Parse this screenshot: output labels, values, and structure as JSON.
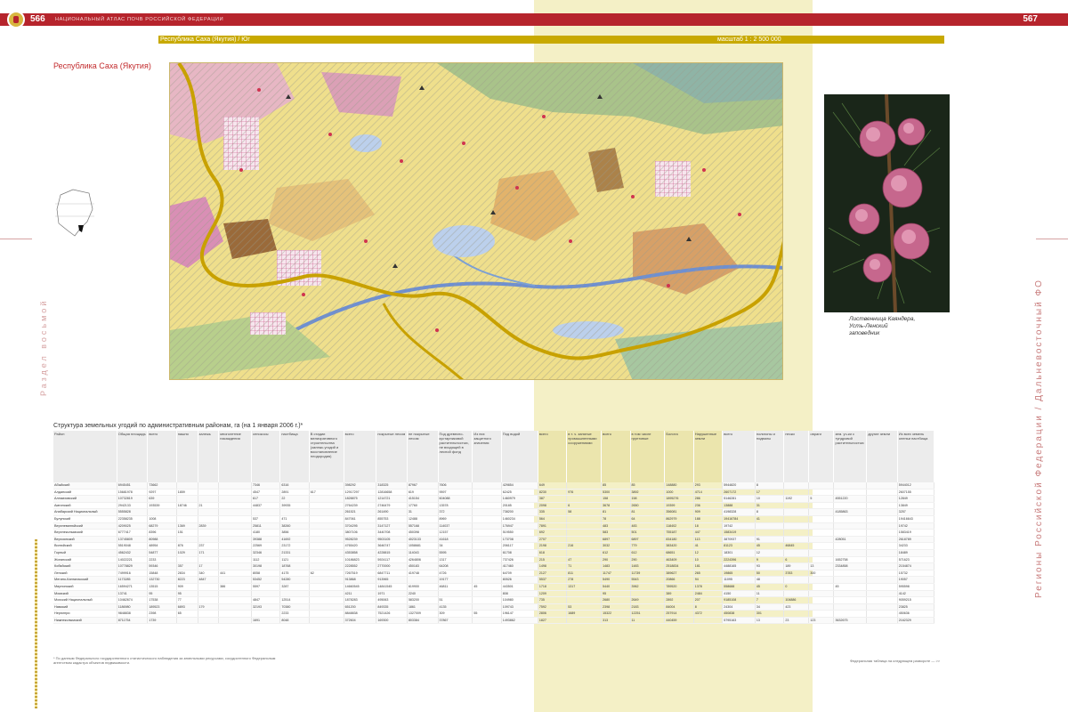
{
  "header": {
    "left_page_number": "566",
    "left_running_title": "национальный атлас почв российской федерации",
    "right_page_number": "567",
    "map_title": "Республика Саха (Якутия) / Юг",
    "scale": "масштаб 1 : 2 500 000"
  },
  "region_title": "Республика Саха (Якутия)",
  "side_labels": {
    "left": "Раздел восьмой",
    "right": "Регионы Российской Федерации / Дальневосточный ФО"
  },
  "photo": {
    "caption_line1": "Лиственница Каяндера,",
    "caption_line2": "Усть-Ленский",
    "caption_line3": "заповедник"
  },
  "table": {
    "title": "Структура земельных угодий по административным районам, га (на 1 января 2006 г.)*",
    "headers": [
      "Район",
      "Общая площадь",
      "всего",
      "пашня",
      "залежь",
      "многолетние насаждения",
      "сенокосы",
      "пастбища",
      "В стадии мелиоративного строительства (залежь угодий и восстановление плодородия)",
      "всего",
      "покрытые лесом",
      "не покрытые лесом",
      "Под древесно-кустарниковой растительностью, не входящей в лесной фонд",
      "Из них защитного значения",
      "Под водой",
      "всего",
      "в т. ч. занятые промышленными сооружениями",
      "всего",
      "в том числе грунтовые",
      "Болота",
      "Нарушенные земли",
      "всего",
      "полигоны и подвалы",
      "пески",
      "овраги",
      "зем. уч-ки с тундровой растительностью",
      "другие земли",
      "Из всех земель оленьи пастбища"
    ],
    "group_headers": {
      "agri": "Сельскохозяйственные угодия",
      "agri_sub": "в том числе",
      "forest": "Лесные земли",
      "forest_sub": "в том числе",
      "build": "Земли застройки",
      "roads": "Под дорогами",
      "other": "Прочие земли",
      "other_sub": "в том числе"
    },
    "rows": [
      [
        "Абыйский",
        "6945451",
        "73662",
        "",
        "",
        "",
        "7346",
        "6316",
        "",
        "398292",
        "318325",
        "87967",
        "7606",
        "",
        "429854",
        "649",
        "",
        "85",
        "85",
        "148880",
        "293",
        "5944820",
        "8",
        "",
        "",
        "",
        "",
        "5944012",
        "3185706"
      ],
      [
        "Алданский",
        "15681978",
        "9297",
        "1859",
        "",
        "",
        "4547",
        "2891",
        "617",
        "12917297",
        "12816658",
        "619",
        "9597",
        "",
        "62425",
        "8230",
        "976",
        "5300",
        "3892",
        "1000",
        "4714",
        "2607172",
        "17",
        "",
        "",
        "",
        "",
        "2607155",
        "2620833"
      ],
      [
        "Аллаиховский",
        "10732819",
        "639",
        "",
        "",
        "",
        "617",
        "22",
        "",
        "1828875",
        "1214721",
        "415154",
        "604088",
        "",
        "1460979",
        "387",
        "",
        "158",
        "158",
        "1895276",
        "286",
        "5146281",
        "10",
        "1192",
        "5",
        "4551220",
        "",
        "12849",
        "6171813"
      ],
      [
        "Амгинский",
        "2942133",
        "193539",
        "18746",
        "21",
        "",
        "44837",
        "39935",
        "",
        "2764239",
        "2746479",
        "17760",
        "13578",
        "",
        "20185",
        "2098",
        "6",
        "3678",
        "2650",
        "19399",
        "236",
        "13888",
        "31",
        "",
        "",
        "",
        "",
        "13849",
        ""
      ],
      [
        "Анабарский Национальный",
        "5555828",
        "",
        "",
        "",
        "",
        "",
        "",
        "",
        "261521",
        "261490",
        "31",
        "372",
        "",
        "738200",
        "335",
        "58",
        "81",
        "81",
        "356081",
        "909",
        "4198328",
        "8",
        "",
        "",
        "4185863",
        "",
        "3257",
        "4185133"
      ],
      [
        "Булунский",
        "22358235",
        "1008",
        "",
        "",
        "",
        "537",
        "471",
        "",
        "847061",
        "855753",
        "12488",
        "8969",
        "",
        "1460234",
        "564",
        "",
        "78",
        "64",
        "862979",
        "188",
        "19416784",
        "41",
        "",
        "",
        "",
        "",
        "19416643",
        "10616219"
      ],
      [
        "Верхневилюйский",
        "4209025",
        "68279",
        "1369",
        "2839",
        "",
        "25811",
        "38260",
        "",
        "3704295",
        "3147127",
        "557168",
        "114037",
        "",
        "176947",
        "7891",
        "",
        "483",
        "483",
        "118402",
        "18",
        "19742",
        "",
        "",
        "",
        "",
        "",
        "19742",
        ""
      ],
      [
        "Верхнеколымский",
        "6777417",
        "8396",
        "151",
        "",
        "",
        "4180",
        "3856",
        "",
        "3807106",
        "3440708",
        "450398",
        "12157",
        "",
        "519550",
        "692",
        "",
        "583",
        "501",
        "755187",
        "447",
        "1583419",
        "",
        "",
        "",
        "",
        "",
        "1583419",
        "451015"
      ],
      [
        "Верхоянский",
        "13745809",
        "80988",
        "",
        "",
        "",
        "39388",
        "41692",
        "",
        "9528239",
        "9503105",
        "4023133",
        "41618",
        "",
        "173708",
        "2707",
        "",
        "6897",
        "6897",
        "834180",
        "113",
        "3870937",
        "91",
        "",
        "",
        "428051",
        "",
        "2618789",
        "7354809"
      ],
      [
        "Вилюйский",
        "5519048",
        "48954",
        "876",
        "237",
        "",
        "22569",
        "23172",
        "",
        "4765420",
        "3646747",
        "1058681",
        "34",
        "",
        "206117",
        "2198",
        "216",
        "3032",
        "779",
        "383420",
        "41",
        "81123",
        "45",
        "46845",
        "",
        "",
        "",
        "34233",
        ""
      ],
      [
        "Горный",
        "4562432",
        "54877",
        "1029",
        "171",
        "",
        "32346",
        "21331",
        "",
        "4353858",
        "4228815",
        "114043",
        "5595",
        "",
        "61708",
        "618",
        "",
        "612",
        "612",
        "68651",
        "12",
        "18301",
        "12",
        "",
        "",
        "",
        "",
        "18489",
        "34568"
      ],
      [
        "Жиганский",
        "14022221",
        "2233",
        "",
        "",
        "",
        "1112",
        "1121",
        "",
        "10186823",
        "5924117",
        "4264806",
        "1317",
        "",
        "737426",
        "215",
        "47",
        "290",
        "290",
        "463409",
        "10",
        "2224396",
        "9",
        "6",
        "",
        "1652758",
        "",
        "571623",
        "7052798"
      ],
      [
        "Кобяйский",
        "10778829",
        "59346",
        "357",
        "17",
        "",
        "30198",
        "18768",
        "",
        "2228552",
        "2770000",
        "450183",
        "64208",
        "",
        "417460",
        "1498",
        "71",
        "1483",
        "1483",
        "2518834",
        "181",
        "4488165",
        "93",
        "189",
        "13",
        "2334858",
        "",
        "2154874",
        "4668113"
      ],
      [
        "Ленский",
        "7499916",
        "15848",
        "2834",
        "340",
        "441",
        "8058",
        "4175",
        "62",
        "7267519",
        "6847711",
        "419748",
        "4726",
        "",
        "64709",
        "2127",
        "811",
        "11747",
        "11739",
        "389627",
        "265",
        "19865",
        "50",
        "3783",
        "300",
        "",
        "",
        "15732",
        ""
      ],
      [
        "Мегино-Кангаласский",
        "1173285",
        "132730",
        "8223",
        "4847",
        "",
        "53452",
        "54280",
        "",
        "913868",
        "913965",
        "",
        "19177",
        "",
        "80526",
        "5537",
        "278",
        "5490",
        "5543",
        "20866",
        "94",
        "11095",
        "48",
        "",
        "",
        "",
        "",
        "19057",
        ""
      ],
      [
        "Мирнинский",
        "16594271",
        "13515",
        "909",
        "",
        "386",
        "5597",
        "3287",
        "",
        "14660545",
        "14841545",
        "619900",
        "46811",
        "45",
        "443501",
        "1718",
        "1317",
        "5440",
        "3962",
        "789520",
        "1378",
        "558688",
        "45",
        "0",
        "",
        "45",
        "",
        "595598",
        "138455"
      ],
      [
        "Момский",
        "13741",
        "95",
        "95",
        "",
        "",
        "",
        "",
        "",
        "4211",
        "1971",
        "2240",
        "",
        "",
        "808",
        "1209",
        "",
        "95",
        "",
        "389",
        "2484",
        "4150",
        "11",
        "",
        "",
        "",
        "",
        "4142",
        ""
      ],
      [
        "Мохский Национальный",
        "10462674",
        "17538",
        "77",
        "",
        "",
        "4847",
        "12514",
        "",
        "1878283",
        "495063",
        "583200",
        "51",
        "",
        "104980",
        "735",
        "",
        "2680",
        "2649",
        "2892",
        "207",
        "9185108",
        "7",
        "104886",
        "",
        "",
        "",
        "9059215",
        "5479785"
      ],
      [
        "Намский",
        "1186980",
        "189523",
        "6893",
        "179",
        "",
        "32193",
        "70380",
        "",
        "651200",
        "849335",
        "1861",
        "4135",
        "",
        "109743",
        "7592",
        "53",
        "2398",
        "2183",
        "84004",
        "8",
        "24304",
        "34",
        "423",
        "",
        "",
        "",
        "23825",
        ""
      ],
      [
        "Нерюнгри",
        "9848838",
        "2398",
        "65",
        "",
        "",
        "",
        "2233",
        "",
        "8848838",
        "7521426",
        "1327009",
        "309",
        "55",
        "196147",
        "2806",
        "1689",
        "15322",
        "12251",
        "257914",
        "4372",
        "450838",
        "301",
        "",
        "",
        "",
        "",
        "450636",
        "4342862"
      ],
      [
        "Нижнеколымский",
        "8711754",
        "1739",
        "",
        "",
        "",
        "1691",
        "8048",
        "",
        "372604",
        "169300",
        "803384",
        "37867",
        "",
        "1493862",
        "1827",
        "",
        "313",
        "11",
        "440459",
        "",
        "5795163",
        "13",
        "23",
        "123",
        "3632675",
        "",
        "2162329",
        "3564637"
      ]
    ]
  },
  "footnote": "* По данным Федерального государственного статистического наблюдения за земельными ресурсами, сосудистенного Федеральным агентством кадастра объектов недвижимости.",
  "footnote_right": "Федеральная таблица на следующем развороте",
  "footnote_right_mark": "—  >>"
}
